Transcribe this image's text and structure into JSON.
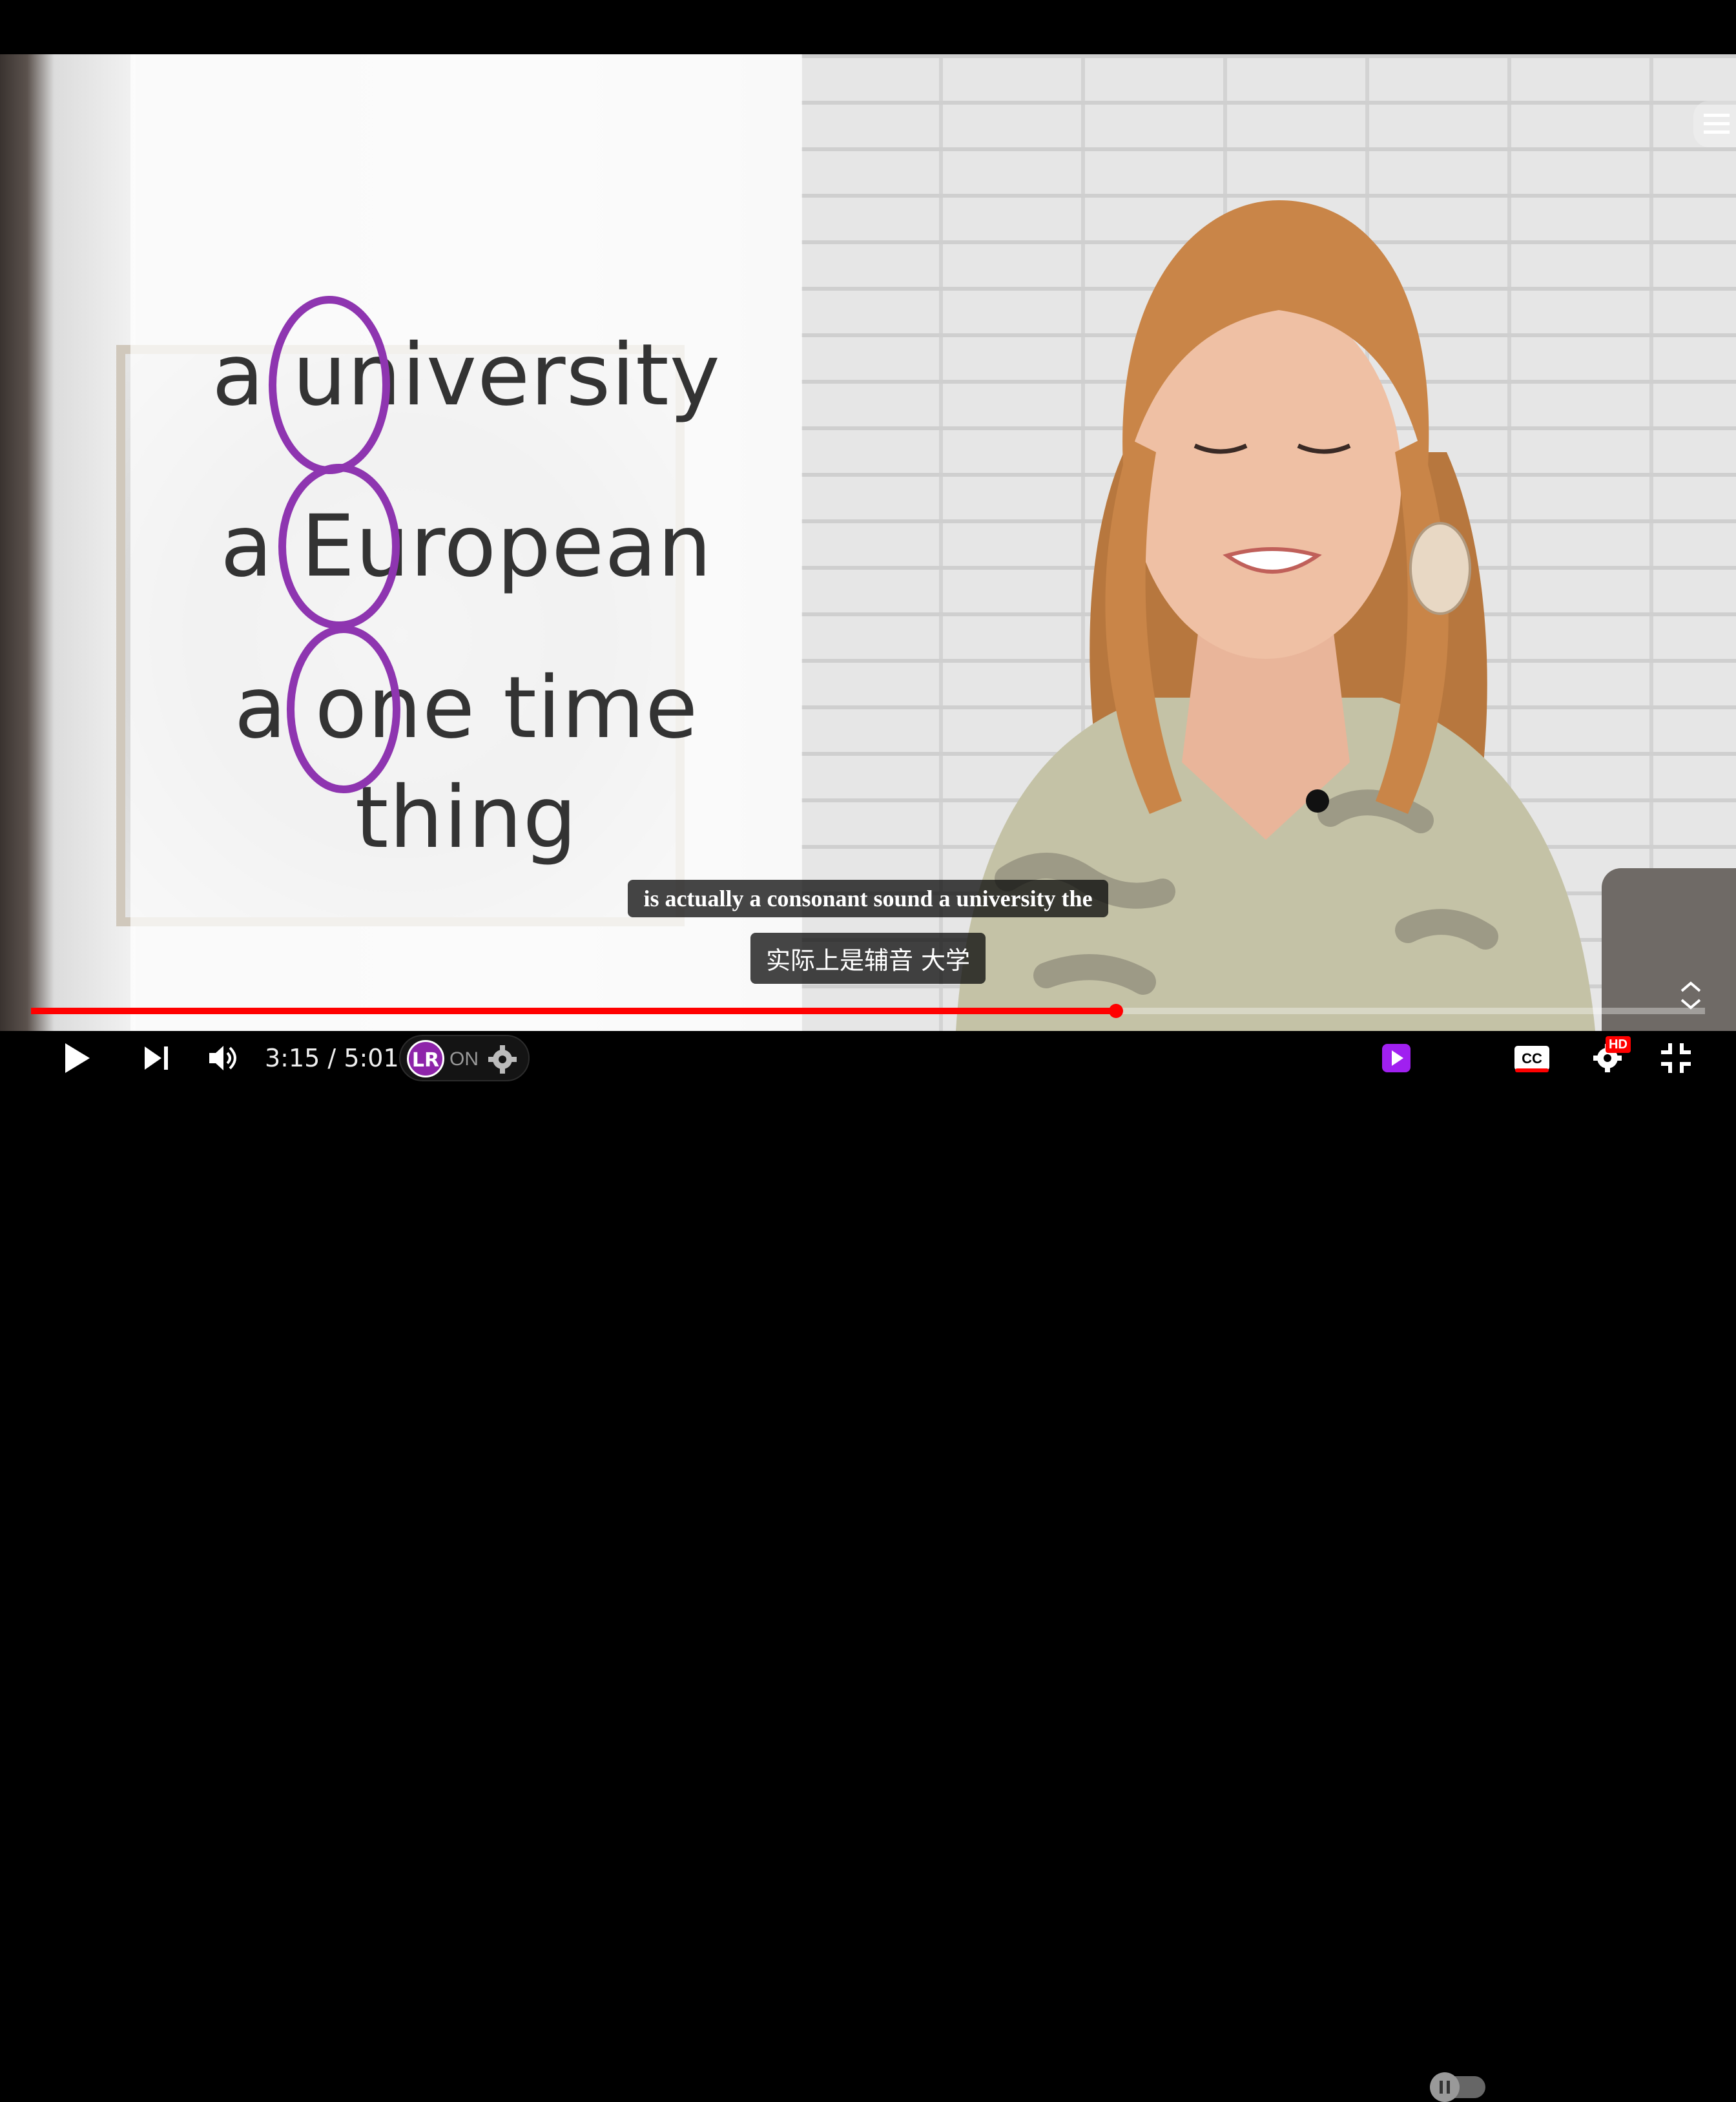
{
  "lesson_words": [
    "a university",
    "a European",
    "a one time",
    "thing"
  ],
  "subtitles": {
    "english": "is actually a consonant sound a university the",
    "chinese": "实际上是辅音 大学"
  },
  "player": {
    "time_current": "3:15",
    "time_separator": " / ",
    "time_total": "5:01",
    "progress_fraction": 0.648,
    "extension_logo": "LR",
    "extension_state": "ON",
    "hd_badge": "HD",
    "accent_color": "#ff0000",
    "icons": [
      "play-icon",
      "next-icon",
      "volume-icon",
      "settings-icon",
      "miniplayer-icon",
      "autoplay-toggle",
      "cc-icon",
      "exit-fullscreen-icon",
      "menu-icon",
      "expand-icon"
    ]
  },
  "colors": {
    "highlight_circle": "#8e35b0",
    "subtitle_bg": "rgba(8,8,8,0.75)"
  }
}
